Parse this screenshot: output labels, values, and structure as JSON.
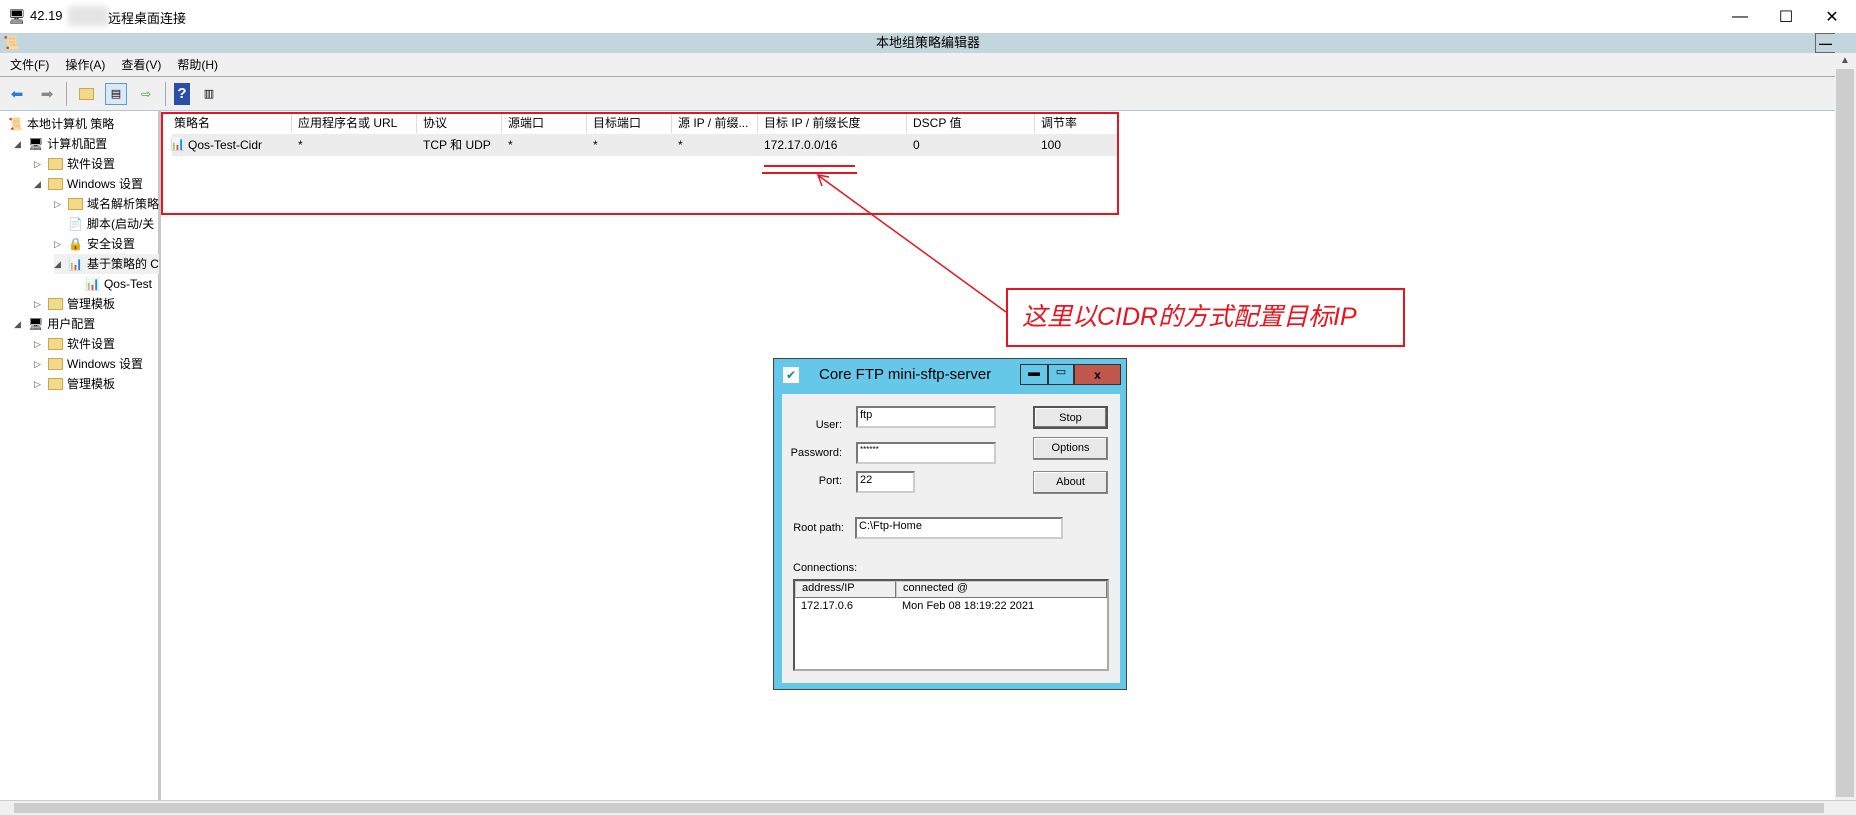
{
  "window": {
    "title_ip": "42.19",
    "title": "远程桌面连接",
    "minimize": "—",
    "maximize": "☐",
    "close": "✕"
  },
  "app": {
    "title": "本地组策略编辑器"
  },
  "menu": [
    "文件(F)",
    "操作(A)",
    "查看(V)",
    "帮助(H)"
  ],
  "toolbar": [
    "back-icon",
    "forward-icon",
    "up-folder-icon",
    "show-tree-icon",
    "export-icon",
    "help-icon",
    "action-pane-icon"
  ],
  "tree": [
    {
      "label": "本地计算机 策略",
      "level": 0
    },
    {
      "label": "计算机配置",
      "level": 1
    },
    {
      "label": "软件设置",
      "level": 2
    },
    {
      "label": "Windows 设置",
      "level": 2
    },
    {
      "label": "域名解析策略",
      "level": 3
    },
    {
      "label": "脚本(启动/关",
      "level": 3
    },
    {
      "label": "安全设置",
      "level": 3
    },
    {
      "label": "基于策略的 C",
      "level": 3
    },
    {
      "label": "Qos-Test",
      "level": 4
    },
    {
      "label": "管理模板",
      "level": 2
    },
    {
      "label": "用户配置",
      "level": 1
    },
    {
      "label": "软件设置",
      "level": 2
    },
    {
      "label": "Windows 设置",
      "level": 2
    },
    {
      "label": "管理模板",
      "level": 2
    }
  ],
  "table": {
    "headers": [
      "策略名",
      "应用程序名或 URL",
      "协议",
      "源端口",
      "目标端口",
      "源 IP / 前缀...",
      "目标 IP / 前缀长度",
      "DSCP 值",
      "调节率"
    ],
    "rows": [
      [
        "Qos-Test-Cidr",
        "*",
        "TCP 和 UDP",
        "*",
        "*",
        "*",
        "172.17.0.0/16",
        "0",
        "100"
      ]
    ]
  },
  "annotation": {
    "text": "这里以CIDR的方式配置目标IP",
    "color": "#e8141e"
  },
  "ftp": {
    "title": "Core FTP mini-sftp-server",
    "user_label": "User:",
    "user": "ftp",
    "password_label": "Password:",
    "password": "******",
    "port_label": "Port:",
    "port": "22",
    "root_label": "Root path:",
    "root": "C:\\Ftp-Home",
    "stop": "Stop",
    "options": "Options",
    "about": "About",
    "connections_label": "Connections:",
    "columns": [
      "address/IP",
      "connected @"
    ],
    "connections": [
      [
        "172.17.0.6",
        "Mon Feb 08 18:19:22 2021"
      ]
    ]
  }
}
